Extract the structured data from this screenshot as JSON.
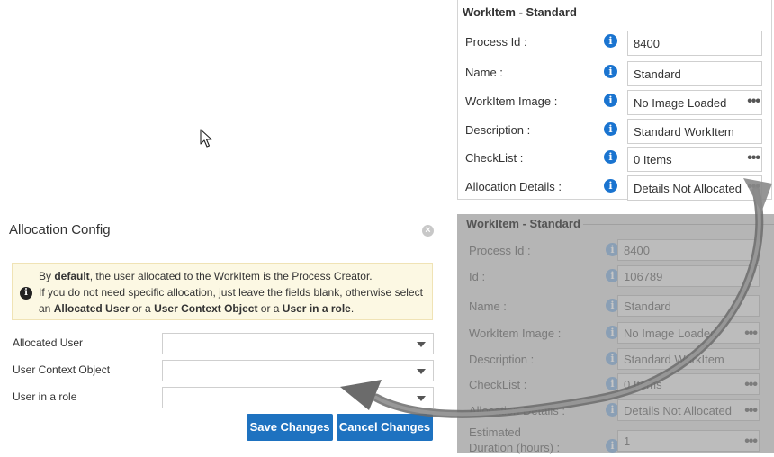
{
  "top_panel": {
    "legend": "WorkItem - Standard",
    "rows": [
      {
        "label": "Process Id :",
        "value": "8400",
        "has_menu": false
      },
      {
        "label": "Name :",
        "value": "Standard",
        "has_menu": false
      },
      {
        "label": "WorkItem Image :",
        "value": "No Image Loaded",
        "has_menu": true
      },
      {
        "label": "Description :",
        "value": "Standard WorkItem",
        "has_menu": false
      },
      {
        "label": "CheckList :",
        "value": "0 Items",
        "has_menu": true
      },
      {
        "label": "Allocation Details :",
        "value": "Details Not Allocated",
        "has_menu": true
      }
    ],
    "menu_glyph": "•••",
    "info_glyph": "i"
  },
  "bg_panel": {
    "legend": "WorkItem - Standard",
    "rows": [
      {
        "label": "Process Id :",
        "value": "8400"
      },
      {
        "label": "Id :",
        "value": "106789"
      },
      {
        "label": "Name :",
        "value": "Standard"
      },
      {
        "label": "WorkItem Image :",
        "value": "No Image Loaded"
      },
      {
        "label": "Description :",
        "value": "Standard WorkItem"
      },
      {
        "label": "CheckList :",
        "value": "0 Items"
      },
      {
        "label": "Allocation Details :",
        "value": "Details Not Allocated"
      },
      {
        "label": "Estimated Duration (hours) :",
        "value": "1"
      }
    ]
  },
  "dialog": {
    "title": "Allocation Config",
    "close_glyph": "×",
    "alert": {
      "icon_glyph": "i",
      "line1_pre": "By ",
      "line1_bold": "default",
      "line1_post": ", the user allocated to the WorkItem is the Process Creator.",
      "line2": "If you do not need specific allocation, just leave the fields blank, otherwise select",
      "line3_pre": "an ",
      "line3_b1": "Allocated User",
      "line3_mid1": " or a ",
      "line3_b2": "User Context Object",
      "line3_mid2": " or a ",
      "line3_b3": "User in a role",
      "line3_post": "."
    },
    "fields": [
      {
        "label": "Allocated User",
        "value": ""
      },
      {
        "label": "User Context Object",
        "value": ""
      },
      {
        "label": "User in a role",
        "value": ""
      }
    ],
    "save_label": "Save Changes",
    "cancel_label": "Cancel Changes"
  },
  "colors": {
    "primary_button": "#1e72c0",
    "info_icon": "#1a74d0",
    "alert_bg": "#fcf8e3"
  }
}
